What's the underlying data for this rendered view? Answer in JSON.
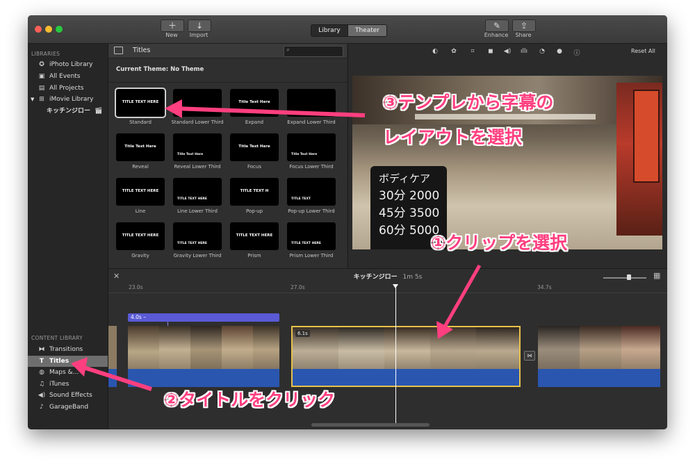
{
  "toolbar": {
    "new_label": "New",
    "import_label": "Import",
    "library_tab": "Library",
    "theater_tab": "Theater",
    "enhance_label": "Enhance",
    "share_label": "Share"
  },
  "sidebar": {
    "libraries_header": "LIBRARIES",
    "libraries": [
      {
        "label": "iPhoto Library",
        "icon": "star-icon"
      },
      {
        "label": "All Events",
        "icon": "events-icon"
      },
      {
        "label": "All Projects",
        "icon": "projects-icon"
      },
      {
        "label": "iMovie Library",
        "icon": "grid-icon"
      },
      {
        "label": "キッチンジロー",
        "icon": "clapper-icon"
      }
    ],
    "content_header": "CONTENT LIBRARY",
    "content": [
      {
        "label": "Transitions",
        "icon": "transitions-icon"
      },
      {
        "label": "Titles",
        "icon": "titles-icon"
      },
      {
        "label": "Maps &…",
        "icon": "globe-icon"
      },
      {
        "label": "iTunes",
        "icon": "music-note-icon"
      },
      {
        "label": "Sound Effects",
        "icon": "speaker-icon"
      },
      {
        "label": "GarageBand",
        "icon": "guitar-icon"
      }
    ]
  },
  "browser": {
    "title": "Titles",
    "theme_label": "Current Theme: No Theme",
    "tiles": [
      {
        "name": "Standard",
        "preview": "TITLE TEXT HERE"
      },
      {
        "name": "Standard Lower Third",
        "preview": ""
      },
      {
        "name": "Expand",
        "preview": "Title Text Here"
      },
      {
        "name": "Expand Lower Third",
        "preview": ""
      },
      {
        "name": "Reveal",
        "preview": "Title Text Here"
      },
      {
        "name": "Reveal Lower Third",
        "preview": "Title Text Here"
      },
      {
        "name": "Focus",
        "preview": "Title Text Here"
      },
      {
        "name": "Focus Lower Third",
        "preview": "Title Text Here"
      },
      {
        "name": "Line",
        "preview": "TITLE TEXT HERE"
      },
      {
        "name": "Line Lower Third",
        "preview": "TITLE TEXT HERE"
      },
      {
        "name": "Pop-up",
        "preview": "TITLE TEXT H"
      },
      {
        "name": "Pop-up Lower Third",
        "preview": "TITLE TEXT"
      },
      {
        "name": "Gravity",
        "preview": "TITLE TEXT HERE"
      },
      {
        "name": "Gravity Lower Third",
        "preview": "TITLE TEXT HERE"
      },
      {
        "name": "Prism",
        "preview": "TITLE TEXT HERE"
      },
      {
        "name": "Prism Lower Third",
        "preview": "TITLE TEXT HERE"
      }
    ]
  },
  "viewer": {
    "reset_label": "Reset All",
    "sign_lines": [
      "ボディケア",
      "30分 2000",
      "45分 3500",
      "60分 5000"
    ]
  },
  "timeline": {
    "project_name": "キッチンジロー",
    "duration": "1m 5s",
    "ticks": [
      "23.0s",
      "27.0s",
      "34.7s"
    ],
    "title_bar_label": "4.0s –",
    "selected_clip_duration": "6.1s"
  },
  "annotations": {
    "step1": "①クリップを選択",
    "step2": "②タイトルをクリック",
    "step3_line1": "③テンプレから字幕の",
    "step3_line2": "レイアウトを選択"
  },
  "colors": {
    "accent_pink": "#ff3f7f",
    "title_bar": "#5a5ad6",
    "audio": "#2a56b0",
    "selection_yellow": "#e8c24a"
  }
}
